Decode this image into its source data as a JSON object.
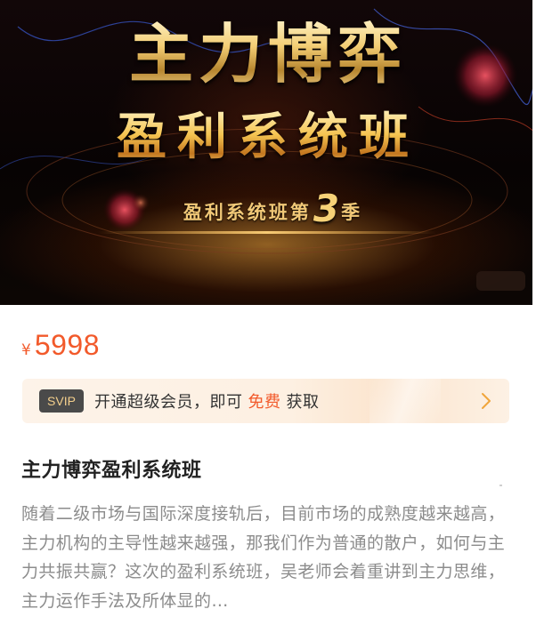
{
  "banner": {
    "title_main": "主力博弈",
    "title_sub": "盈利系统班",
    "season_prefix": "盈利系统班第",
    "season_number": "3",
    "season_suffix": "季"
  },
  "price": {
    "currency": "¥",
    "amount": "5998"
  },
  "svip": {
    "badge": "SVIP",
    "text_before": "开通超级会员，即可",
    "free": "免费",
    "text_after": "获取",
    "arrow_icon": "chevron-right-icon"
  },
  "course": {
    "title": "主力博弈盈利系统班",
    "description": "随着二级市场与国际深度接轨后，目前市场的成熟度越来越高，主力机构的主导性越来越强，那我们作为普通的散户，如何与主力共振共赢？这次的盈利系统班，吴老师会着重讲到主力思维，主力运作手法及所体显的…"
  },
  "colors": {
    "accent": "#f25a2b",
    "badge_bg": "#4a4a4a",
    "badge_text": "#f3cf8c",
    "title_gold": "#f3d58a"
  }
}
